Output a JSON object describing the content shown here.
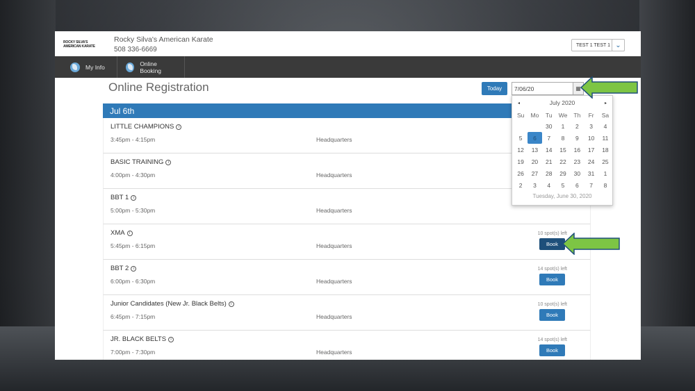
{
  "brand": {
    "logo_text_1": "ROCKY SILVA'S",
    "logo_text_2": "AMERICAN KARATE",
    "name": "Rocky Silva's American Karate",
    "phone": "508 336-6669"
  },
  "user": {
    "selected": "TEST 1 TEST 1"
  },
  "nav": {
    "items": [
      {
        "label": "My Info"
      },
      {
        "label": "Online Booking"
      }
    ]
  },
  "page": {
    "title": "Online Registration",
    "today_label": "Today",
    "date_value": "7/06/20",
    "day_header": "Jul 6th"
  },
  "calendar": {
    "month": "July 2020",
    "prev": "◂",
    "next": "▸",
    "weekdays": [
      "Su",
      "Mo",
      "Tu",
      "We",
      "Th",
      "Fr",
      "Sa"
    ],
    "days": [
      "",
      "",
      "30",
      "1",
      "2",
      "3",
      "4",
      "5",
      "6",
      "7",
      "8",
      "9",
      "10",
      "11",
      "12",
      "13",
      "14",
      "15",
      "16",
      "17",
      "18",
      "19",
      "20",
      "21",
      "22",
      "23",
      "24",
      "25",
      "26",
      "27",
      "28",
      "29",
      "30",
      "31",
      "1",
      "2",
      "3",
      "4",
      "5",
      "6",
      "7",
      "8"
    ],
    "selected_day": "6",
    "footer": "Tuesday, June 30, 2020"
  },
  "classes": [
    {
      "name": "LITTLE CHAMPIONS",
      "time": "3:45pm - 4:15pm",
      "location": "Headquarters",
      "spots": "",
      "book": ""
    },
    {
      "name": "BASIC TRAINING",
      "time": "4:00pm - 4:30pm",
      "location": "Headquarters",
      "spots": "",
      "book": ""
    },
    {
      "name": "BBT 1",
      "time": "5:00pm - 5:30pm",
      "location": "Headquarters",
      "spots": "",
      "book": ""
    },
    {
      "name": "XMA",
      "time": "5:45pm - 6:15pm",
      "location": "Headquarters",
      "spots": "10 spot(s) left",
      "book": "Book"
    },
    {
      "name": "BBT 2",
      "time": "6:00pm - 6:30pm",
      "location": "Headquarters",
      "spots": "14 spot(s) left",
      "book": "Book"
    },
    {
      "name": "Junior Candidates (New Jr. Black Belts)",
      "time": "6:45pm - 7:15pm",
      "location": "Headquarters",
      "spots": "10 spot(s) left",
      "book": "Book"
    },
    {
      "name": "JR. BLACK BELTS",
      "time": "7:00pm - 7:30pm",
      "location": "Headquarters",
      "spots": "14 spot(s) left",
      "book": "Book"
    }
  ],
  "colors": {
    "primary": "#2f7ab8",
    "nav_bg": "#3a3a3a",
    "arrow": "#7dc544"
  },
  "icons": {
    "calendar": "calendar-icon",
    "info": "info-icon",
    "chevron": "chevron-down-icon"
  }
}
